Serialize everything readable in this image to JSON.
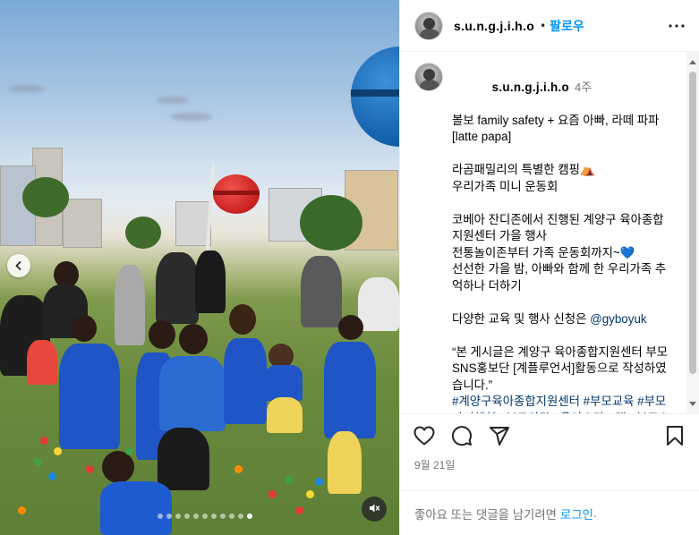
{
  "header": {
    "username": "s.u.n.g.j.i.h.o",
    "separator": "•",
    "follow_label": "팔로우",
    "more_label": "•••"
  },
  "caption": {
    "username": "s.u.n.g.j.i.h.o",
    "ago": "4주",
    "lines": [
      "볼보 family safety + 요즘 아빠, 라떼 파파 [latte papa]",
      "",
      "라곰패밀리의 특별한 캠핑⛺",
      "우리가족 미니 운동회",
      "",
      "코베아 잔디존에서 진행된 계양구 육아종합지원센터 가을 행사",
      "전통놀이존부터 가족 운동회까지~💙",
      "선선한 가을 밤, 아빠와 함께 한 우리가족 추억하나 더하기",
      ""
    ],
    "inquiry_prefix": "다양한 교육 및 행사 신청은 ",
    "inquiry_mention": "@gyboyuk",
    "notice": "“본 게시글은 계양구 육아종합지원센터 부모SNS홍보단 [계플루언서]활동으로 작성하였습니다.”",
    "hashtags": "#계양구육아종합지원센터 #부모교육 #부모자녀체험 #부모상담 #육아스타그램 #부모스타그램 #부모SNS홍보단_계플루언서 #함께키우는아이 #함께만드는미래 #행복육아파트너 #가을운동회 #캠핑 #우리가족"
  },
  "media": {
    "carousel_total": 11,
    "carousel_active_index": 10
  },
  "actions": {
    "like_icon": "heart-icon",
    "comment_icon": "comment-icon",
    "share_icon": "share-icon",
    "save_icon": "bookmark-icon"
  },
  "date": "9월 21일",
  "footer": {
    "prompt": "좋아요 또는 댓글을 남기려면",
    "login_label": "로그인",
    "period": "."
  }
}
